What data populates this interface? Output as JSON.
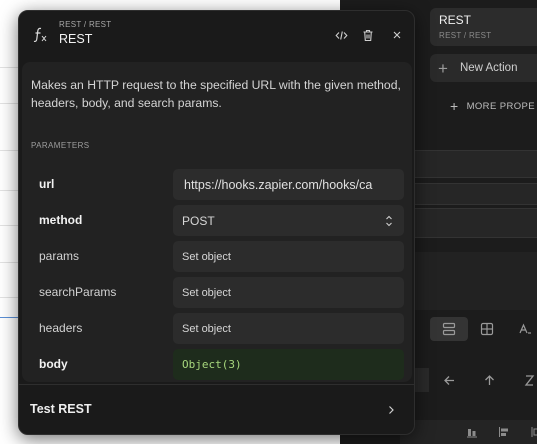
{
  "panel": {
    "breadcrumb": "REST / REST",
    "title": "REST",
    "description": "Makes an HTTP request to the specified URL with the given method, headers, body, and search params.",
    "params_label": "PARAMETERS",
    "parameters": [
      {
        "name": "url",
        "bold": true,
        "value": "https://hooks.zapier.com/hooks/ca",
        "type": "text"
      },
      {
        "name": "method",
        "bold": true,
        "value": "POST",
        "type": "select"
      },
      {
        "name": "params",
        "bold": false,
        "value": "Set object",
        "type": "object"
      },
      {
        "name": "searchParams",
        "bold": false,
        "value": "Set object",
        "type": "object"
      },
      {
        "name": "headers",
        "bold": false,
        "value": "Set object",
        "type": "object"
      },
      {
        "name": "body",
        "bold": true,
        "value": "Object(3)",
        "type": "code"
      }
    ],
    "footer_label": "Test REST",
    "icons": {
      "function": "fx-icon",
      "code": "code-icon",
      "delete": "trash-icon",
      "close": "close-icon",
      "footer": "chevron-right-icon"
    }
  },
  "right_panel": {
    "rest_card": {
      "title": "REST",
      "subtitle": "REST / REST"
    },
    "new_action_label": "New Action",
    "more_props_label": "MORE PROPE"
  }
}
